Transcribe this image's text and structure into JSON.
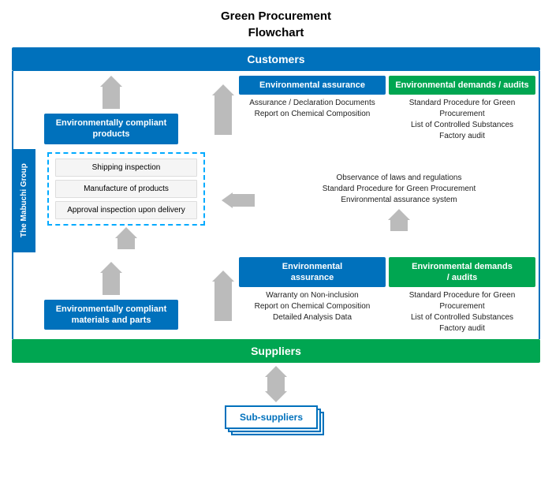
{
  "title": {
    "line1": "Green Procurement",
    "line2": "Flowchart"
  },
  "customers": {
    "label": "Customers"
  },
  "suppliers": {
    "label": "Suppliers"
  },
  "mabuchi": {
    "label": "The Mabuchi Group"
  },
  "top_left": {
    "blue_label": "Environmentally compliant products"
  },
  "top_right": {
    "env_assurance": {
      "header": "Environmental assurance",
      "text": "Assurance / Declaration Documents\nReport on Chemical Composition"
    },
    "env_demands": {
      "header": "Environmental demands / audits",
      "text": "Standard Procedure for Green Procurement\nList of Controlled Substances\nFactory audit"
    }
  },
  "mabuchi_items": [
    "Shipping inspection",
    "Manufacture of products",
    "Approval inspection upon delivery"
  ],
  "mabuchi_right_text": "Observance of laws and regulations\nStandard Procedure for Green Procurement\nEnvironmental assurance system",
  "bottom_left": {
    "blue_label": "Environmentally compliant\nmaterials and parts"
  },
  "bottom_right": {
    "env_assurance": {
      "header": "Environmental\nassurance",
      "text": "Warranty on Non-inclusion\nReport on Chemical Composition\nDetailed Analysis Data"
    },
    "env_demands": {
      "header": "Environmental demands\n/ audits",
      "text": "Standard Procedure for Green Procurement\nList of Controlled Substances\nFactory audit"
    }
  },
  "subsuppliers": {
    "label": "Sub-suppliers"
  }
}
